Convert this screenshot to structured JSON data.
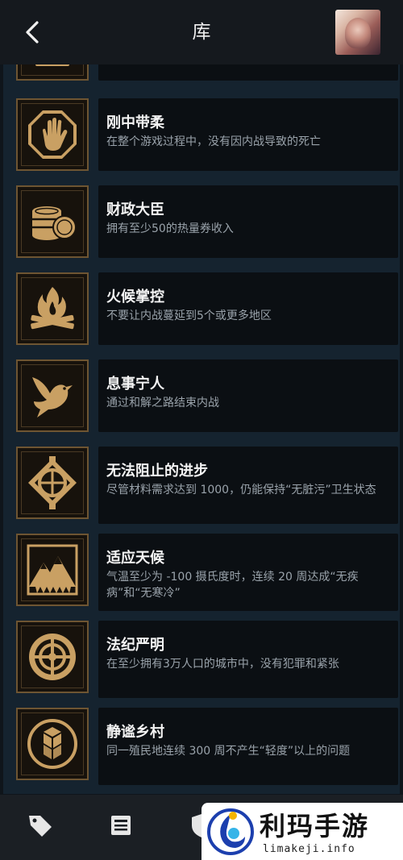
{
  "header": {
    "title": "库"
  },
  "achievements": [
    {
      "name": "刚中带柔",
      "desc": "在整个游戏过程中，没有因内战导致的死亡",
      "icon": "stop-hand-icon"
    },
    {
      "name": "财政大臣",
      "desc": "拥有至少50的热量券收入",
      "icon": "coin-stack-icon"
    },
    {
      "name": "火候掌控",
      "desc": "不要让内战蔓延到5个或更多地区",
      "icon": "campfire-icon"
    },
    {
      "name": "息事宁人",
      "desc": "通过和解之路结束内战",
      "icon": "dove-icon"
    },
    {
      "name": "无法阻止的进步",
      "desc": "尽管材料需求达到 1000，仍能保持“无脏污”卫生状态",
      "icon": "gear-emblem-icon"
    },
    {
      "name": "适应天候",
      "desc": "气温至少为 -100 摄氏度时，连续 20 周达成“无疾病”和“无寒冷”",
      "icon": "frost-mountain-icon"
    },
    {
      "name": "法纪严明",
      "desc": "在至少拥有3万人口的城市中，没有犯罪和紧张",
      "icon": "law-emblem-icon"
    },
    {
      "name": "静谧乡村",
      "desc": "同一殖民地连续 300 周不产生“轻度”以上的问题",
      "icon": "cube-emblem-icon"
    }
  ],
  "nav": [
    "tag-icon",
    "list-icon",
    "shield-icon"
  ],
  "watermark": {
    "text": "利玛手游",
    "url": "limakeji.info"
  },
  "colors": {
    "gold": "#c9a063",
    "card": "#0b0f13",
    "panel": "#15232f"
  }
}
